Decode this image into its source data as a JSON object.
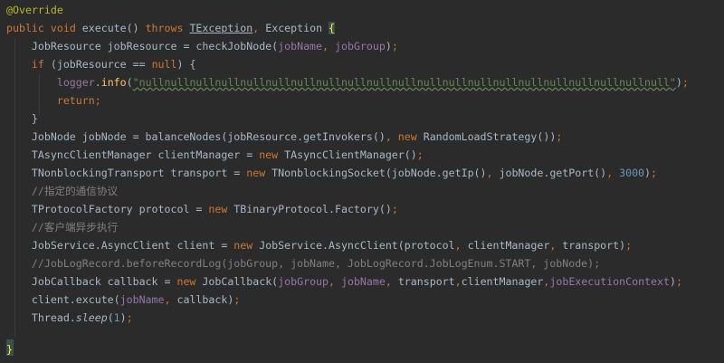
{
  "editor": {
    "language": "java",
    "colors": {
      "background": "#2b2b2b",
      "default_text": "#a9b7c6",
      "keyword": "#cc7832",
      "annotation": "#bbb529",
      "method": "#ffc66d",
      "field": "#9876aa",
      "string": "#6a8759",
      "number": "#6897bb",
      "comment": "#808080",
      "brace_highlight_bg": "#3b514d",
      "brace_highlight_fg": "#ffef28"
    },
    "lines": [
      "@Override",
      "public void execute() throws TException, Exception {",
      "    JobResource jobResource = checkJobNode(jobName, jobGroup);",
      "    if (jobResource == null) {",
      "        logger.info(\"nullnullnullnullnullnullnullnullnullnullnullnullnullnullnullnullnullnullnullnullnull\");",
      "        return;",
      "    }",
      "    JobNode jobNode = balanceNodes(jobResource.getInvokers(), new RandomLoadStrategy());",
      "    TAsyncClientManager clientManager = new TAsyncClientManager();",
      "    TNonblockingTransport transport = new TNonblockingSocket(jobNode.getIp(), jobNode.getPort(), 3000);",
      "    //指定的通信协议",
      "    TProtocolFactory protocol = new TBinaryProtocol.Factory();",
      "    //客户端异步执行",
      "    JobService.AsyncClient client = new JobService.AsyncClient(protocol, clientManager, transport);",
      "    //JobLogRecord.beforeRecordLog(jobGroup, jobName, JobLogRecord.JobLogEnum.START, jobNode);",
      "    JobCallback callback = new JobCallback(jobGroup, jobName, transport,clientManager,jobExecutionContext);",
      "    client.excute(jobName, callback);",
      "    Thread.sleep(1);",
      "}"
    ]
  }
}
